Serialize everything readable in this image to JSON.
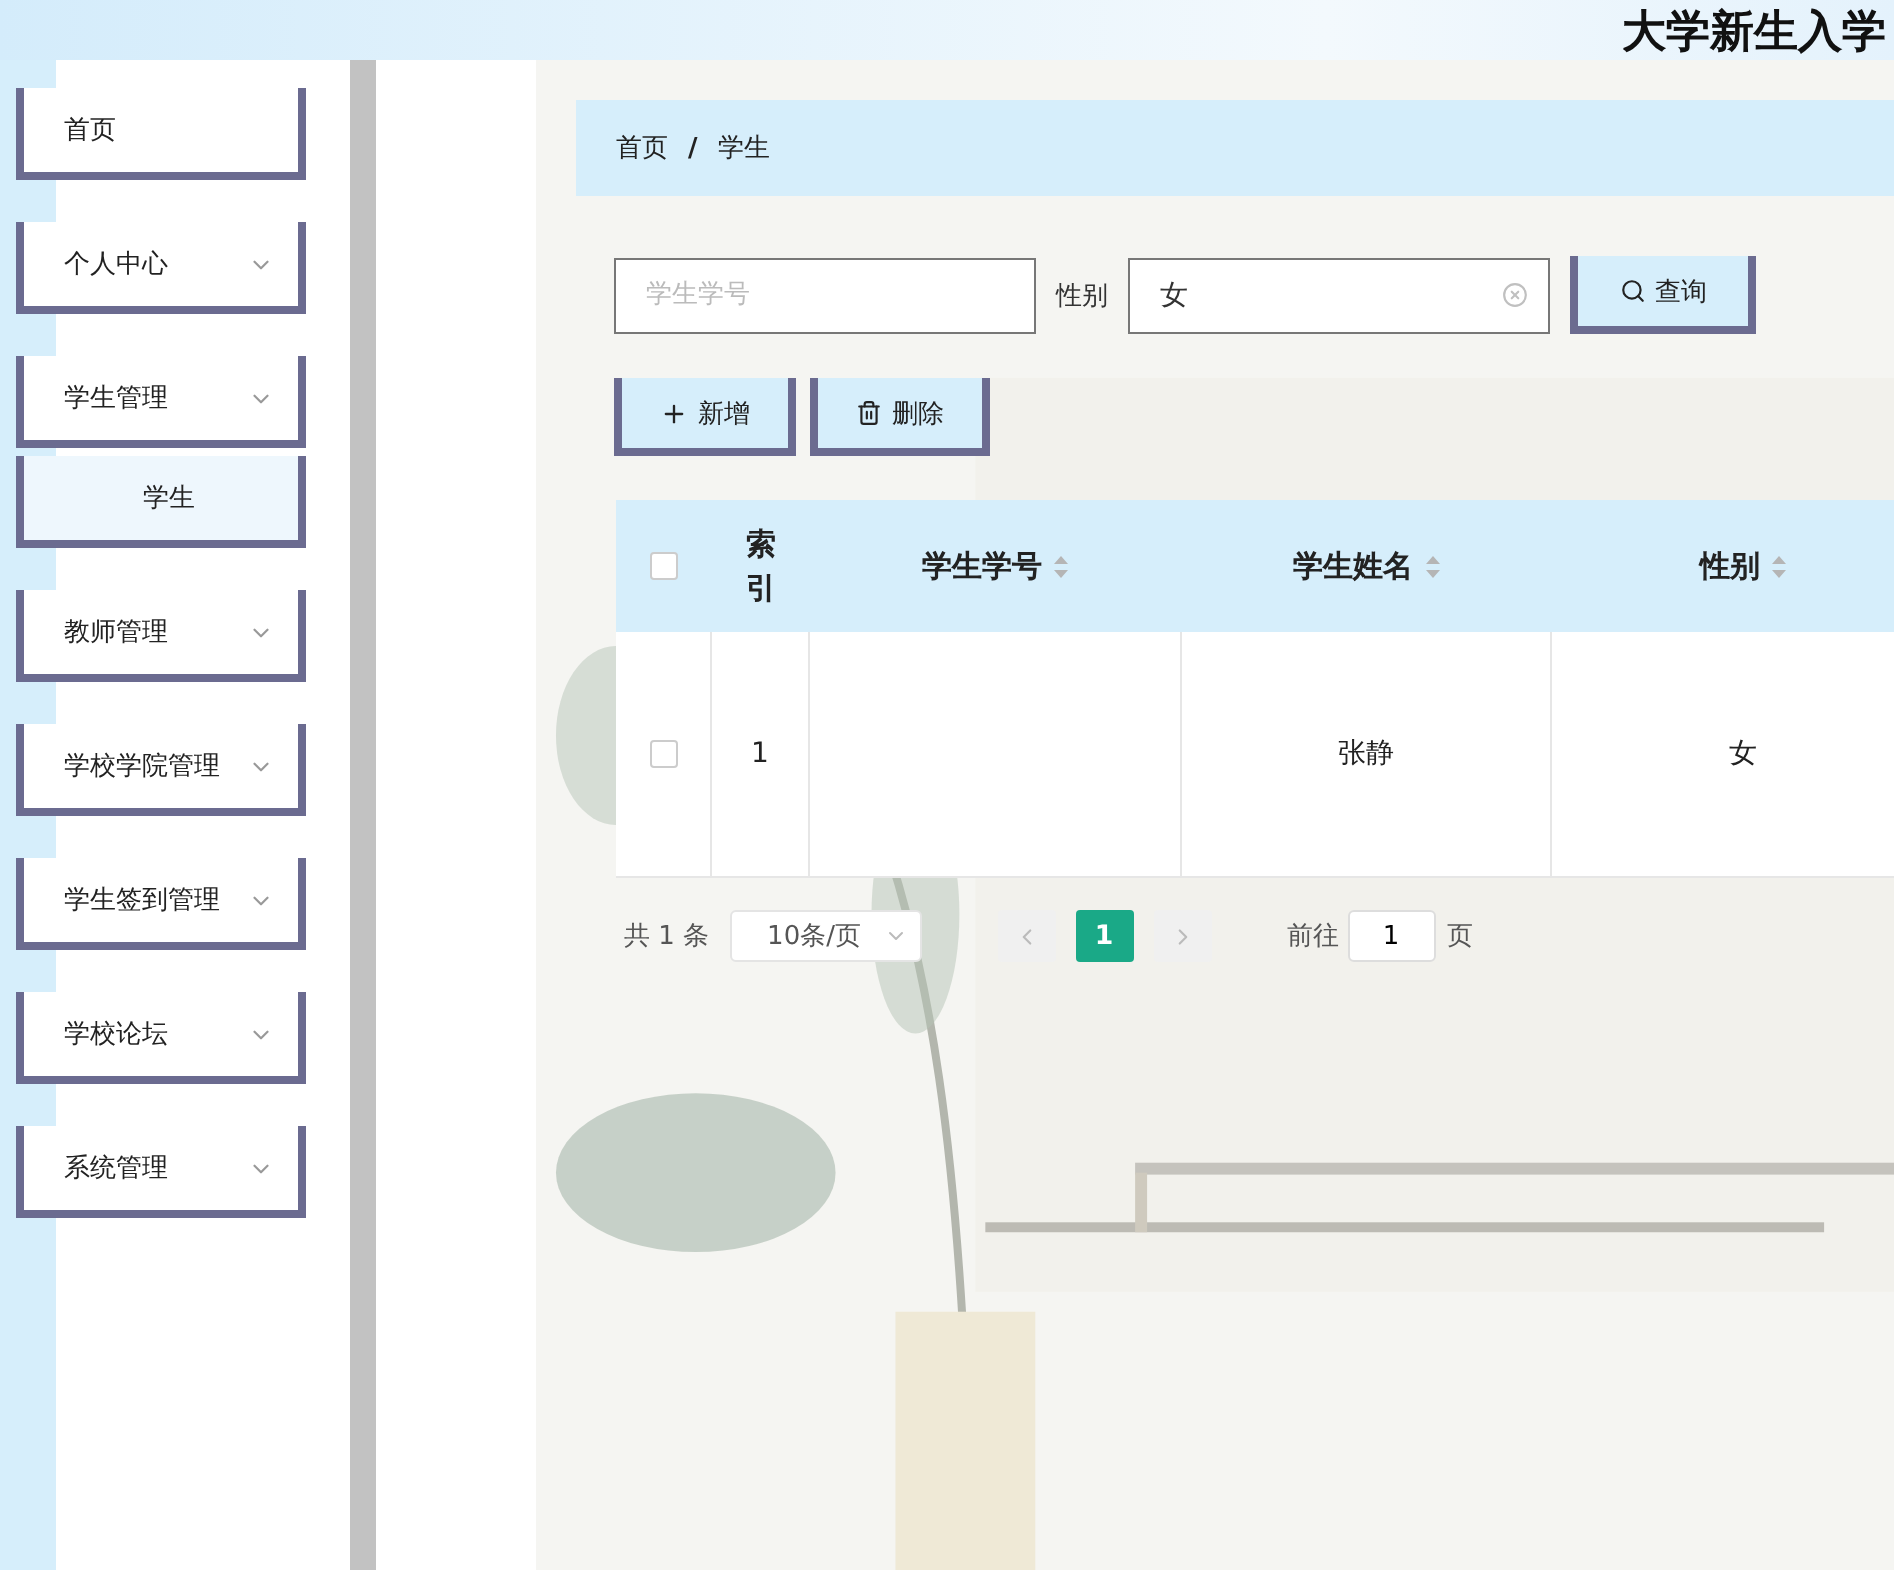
{
  "header": {
    "title": "大学新生入学"
  },
  "sidebar": {
    "items": [
      {
        "label": "首页",
        "expandable": false,
        "selected": false
      },
      {
        "label": "个人中心",
        "expandable": true,
        "selected": false
      },
      {
        "label": "学生管理",
        "expandable": true,
        "selected": false,
        "children": [
          {
            "label": "学生",
            "selected": true
          }
        ]
      },
      {
        "label": "教师管理",
        "expandable": true,
        "selected": false
      },
      {
        "label": "学校学院管理",
        "expandable": true,
        "selected": false
      },
      {
        "label": "学生签到管理",
        "expandable": true,
        "selected": false
      },
      {
        "label": "学校论坛",
        "expandable": true,
        "selected": false
      },
      {
        "label": "系统管理",
        "expandable": true,
        "selected": false
      }
    ]
  },
  "breadcrumb": [
    "首页",
    "学生"
  ],
  "breadcrumb_separator": "/",
  "search": {
    "id_placeholder": "学生学号",
    "gender_label": "性别",
    "gender_value": "女",
    "button": "查询"
  },
  "actions": [
    {
      "kind": "add",
      "label": "新增"
    },
    {
      "kind": "delete",
      "label": "删除"
    }
  ],
  "table": {
    "all_checked": false,
    "columns": [
      {
        "label": "索引",
        "sortable": false
      },
      {
        "label": "学生学号",
        "sortable": true
      },
      {
        "label": "学生姓名",
        "sortable": true
      },
      {
        "label": "性别",
        "sortable": true
      }
    ],
    "rows": [
      {
        "checked": false,
        "cells": [
          "1",
          "",
          "张静",
          "女"
        ]
      }
    ]
  },
  "pagination": {
    "total": "共 1 条",
    "page_size": "10条/页",
    "pages": [
      {
        "label": "1",
        "selected": true
      }
    ],
    "goto_label": "前往",
    "goto_value": "1",
    "page_suffix": "页"
  }
}
